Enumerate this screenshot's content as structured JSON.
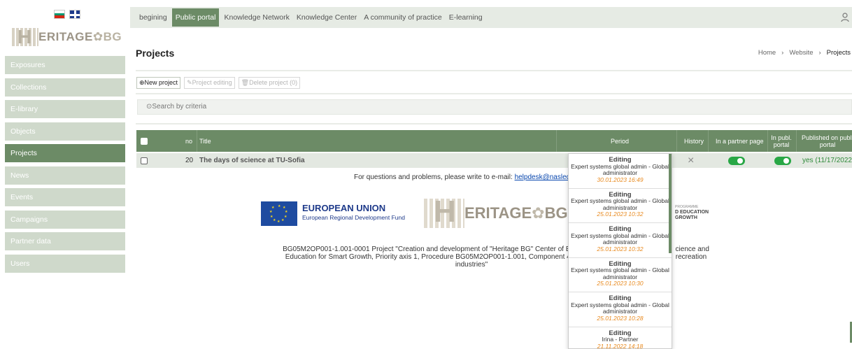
{
  "sidebar": {
    "logo_text": "ERITAGE",
    "logo_suffix": "BG",
    "items": [
      {
        "label": "Exposures"
      },
      {
        "label": "Collections"
      },
      {
        "label": "E-library"
      },
      {
        "label": "Objects"
      },
      {
        "label": "Projects",
        "active": true
      },
      {
        "label": "News"
      },
      {
        "label": "Events"
      },
      {
        "label": "Campaigns"
      },
      {
        "label": "Partner data"
      },
      {
        "label": "Users"
      }
    ]
  },
  "topnav": {
    "tabs": [
      {
        "label": "begining"
      },
      {
        "label": "Public portal",
        "active": true
      },
      {
        "label": "Knowledge Network"
      },
      {
        "label": "Knowledge Center"
      },
      {
        "label": "A community of practice"
      },
      {
        "label": "E-learning"
      }
    ],
    "user_icon": "user-icon"
  },
  "page": {
    "title": "Projects",
    "breadcrumb": [
      "Home",
      "Website",
      "Projects"
    ]
  },
  "toolbar": {
    "new_label": "⊕New project",
    "edit_label": "✎Project editing",
    "delete_label": "🗑Delete project (0)"
  },
  "search": {
    "label": "⊙Search by criteria"
  },
  "table": {
    "headers": {
      "no": "no",
      "title": "Title",
      "period": "Period",
      "history": "History",
      "partner": "In a partner page",
      "publ": "In publ. portal",
      "published": "Published on publ. portal"
    },
    "rows": [
      {
        "no": "20",
        "title": "The days of science at TU-Sofia",
        "history": "×",
        "published": "yes (11/17/2022"
      }
    ]
  },
  "footer": {
    "note_prefix": "For questions and problems, please write to e-mail: ",
    "email": "helpdesk@nasledst",
    "eu_title": "EUROPEAN UNION",
    "eu_sub": "European Regional Development Fund",
    "logo2_text": "ERITAGE",
    "logo2_suffix": "BG",
    "prog_small": "PROGRAMME",
    "prog_line1": "D EDUCATION",
    "prog_line2": "GROWTH",
    "desc_line1": "BG05M2OP001-1.001-0001 Project \"Creation and development of \"Heritage BG\" Center of E",
    "desc_line1b": "cience and",
    "desc_line2": "Education for Smart Growth, Priority axis 1, Procedure BG05M2OP001-1.001, Component 4",
    "desc_line2b": "recreation",
    "desc_line3": "industries\""
  },
  "history": [
    {
      "action": "Editing",
      "user": "Expert systems global admin - Global administrator",
      "time": "30.01.2023 16:49"
    },
    {
      "action": "Editing",
      "user": "Expert systems global admin - Global administrator",
      "time": "25.01.2023 10:32"
    },
    {
      "action": "Editing",
      "user": "Expert systems global admin - Global administrator",
      "time": "25.01.2023 10:32"
    },
    {
      "action": "Editing",
      "user": "Expert systems global admin - Global administrator",
      "time": "25.01.2023 10:30"
    },
    {
      "action": "Editing",
      "user": "Expert systems global admin - Global administrator",
      "time": "25.01.2023 10:28"
    },
    {
      "action": "Editing",
      "user": "Irina - Partner",
      "time": "21.11.2022 14:18"
    }
  ],
  "colors": {
    "accent": "#6c8b66",
    "toggle_on": "#28a745",
    "time": "#e8891d"
  }
}
